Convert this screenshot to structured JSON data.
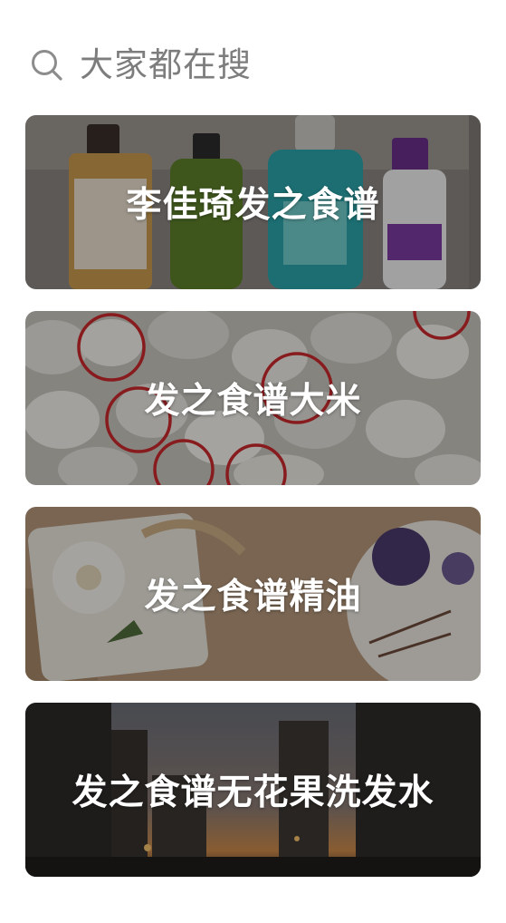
{
  "header": {
    "icon": "search-icon",
    "title": "大家都在搜"
  },
  "cards": [
    {
      "label": "李佳琦发之食谱"
    },
    {
      "label": "发之食谱大米"
    },
    {
      "label": "发之食谱精油"
    },
    {
      "label": "发之食谱无花果洗发水"
    }
  ],
  "colors": {
    "background": "#ffffff",
    "header_text": "#7d7d7d",
    "card_text": "#ffffff"
  }
}
